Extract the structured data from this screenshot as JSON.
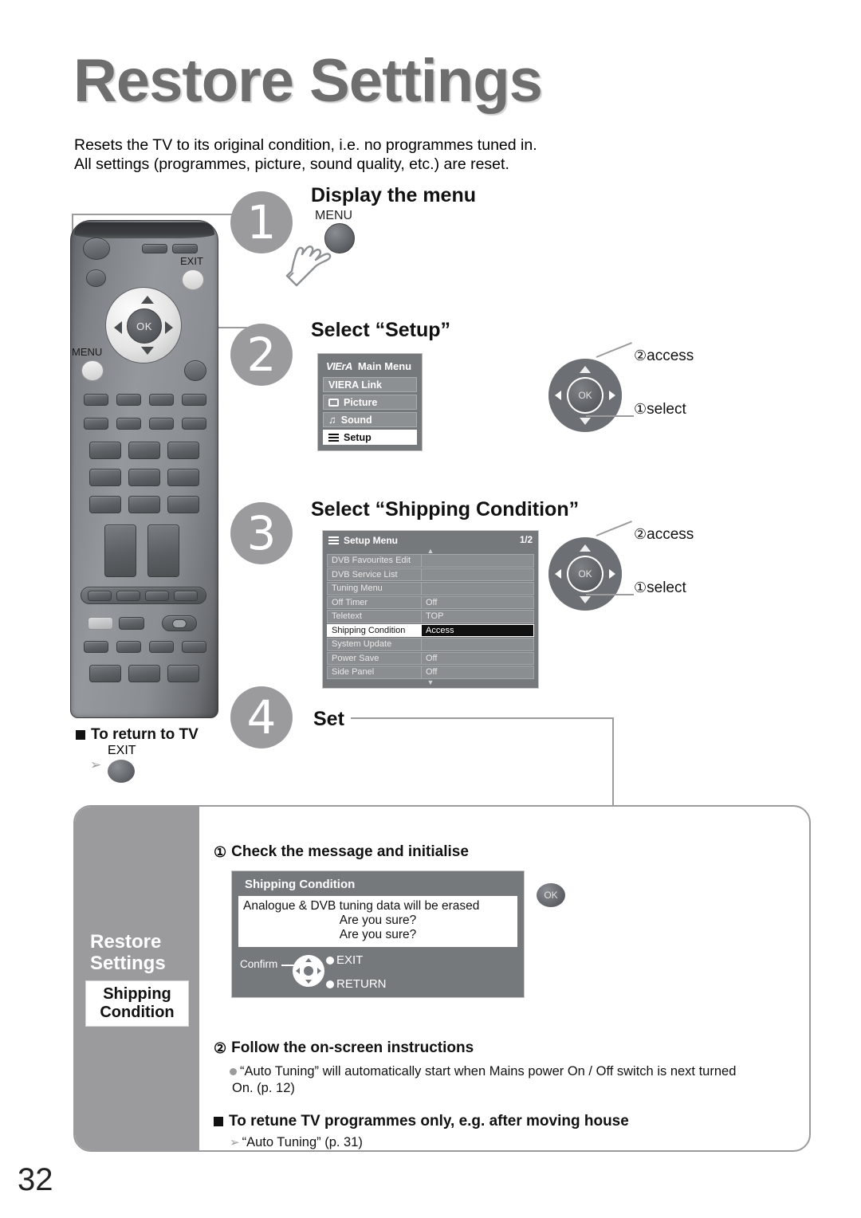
{
  "page": {
    "title": "Restore Settings",
    "intro_line1": "Resets the TV to its original condition, i.e. no programmes tuned in.",
    "intro_line2": "All settings (programmes, picture, sound quality, etc.) are reset.",
    "page_number": "32"
  },
  "steps": [
    {
      "number": "1",
      "heading": "Display the menu"
    },
    {
      "number": "2",
      "heading": "Select “Setup”"
    },
    {
      "number": "3",
      "heading": "Select “Shipping Condition”"
    },
    {
      "number": "4",
      "heading": "Set"
    }
  ],
  "remote": {
    "menu_label": "MENU",
    "exit_label": "EXIT",
    "ok_label": "OK"
  },
  "menu_press": {
    "label": "MENU",
    "icon": "pointing-hand-icon"
  },
  "main_menu": {
    "brand": "VIErA",
    "title": "Main Menu",
    "items": [
      {
        "label": "VIERA Link",
        "icon": "none",
        "selected": false
      },
      {
        "label": "Picture",
        "icon": "screen-icon",
        "selected": false
      },
      {
        "label": "Sound",
        "icon": "music-note-icon",
        "selected": false
      },
      {
        "label": "Setup",
        "icon": "list-icon",
        "selected": true
      }
    ]
  },
  "setup_menu": {
    "title": "Setup Menu",
    "page_indicator": "1/2",
    "rows": [
      {
        "label": "DVB Favourites Edit",
        "value": "",
        "selected": false
      },
      {
        "label": "DVB Service List",
        "value": "",
        "selected": false
      },
      {
        "label": "Tuning Menu",
        "value": "",
        "selected": false
      },
      {
        "label": "Off Timer",
        "value": "Off",
        "selected": false
      },
      {
        "label": "Teletext",
        "value": "TOP",
        "selected": false
      },
      {
        "label": "Shipping Condition",
        "value": "Access",
        "selected": true
      },
      {
        "label": "System Update",
        "value": "",
        "selected": false
      },
      {
        "label": "Power Save",
        "value": "Off",
        "selected": false
      },
      {
        "label": "Side Panel",
        "value": "Off",
        "selected": false
      }
    ]
  },
  "nav_hints": {
    "access_num": "②",
    "access_label": "access",
    "select_num": "①",
    "select_label": "select",
    "ok_label": "OK"
  },
  "return_to_tv": {
    "heading": "To return to TV",
    "button_label": "EXIT"
  },
  "bottom_panel": {
    "side_title_line1": "Restore",
    "side_title_line2": "Settings",
    "chip_line1": "Shipping",
    "chip_line2": "Condition",
    "item1_num": "①",
    "item1_heading": "Check the message and initialise",
    "item2_num": "②",
    "item2_heading": "Follow the on-screen instructions",
    "item2_body_line1": "“Auto Tuning” will automatically start when Mains power On / Off switch is next turned",
    "item2_body_line2": "On. (p. 12)",
    "retune_heading": "To retune TV programmes only, e.g. after moving house",
    "retune_body": "“Auto Tuning” (p. 31)",
    "ok_button_label": "OK"
  },
  "dialog": {
    "title": "Shipping Condition",
    "message_line1": "Analogue & DVB tuning data will be erased",
    "message_line2": "Are you sure?",
    "message_line3": "Are you sure?",
    "confirm_label": "Confirm",
    "exit_label": "EXIT",
    "return_label": "RETURN"
  },
  "colors": {
    "title_grey": "#6e6e6e",
    "accent_grey": "#9b9b9e",
    "osd_bg": "#76797c",
    "osd_row": "#8b8e91",
    "selected_bg": "#ffffff",
    "selected_value_bg": "#111111"
  }
}
